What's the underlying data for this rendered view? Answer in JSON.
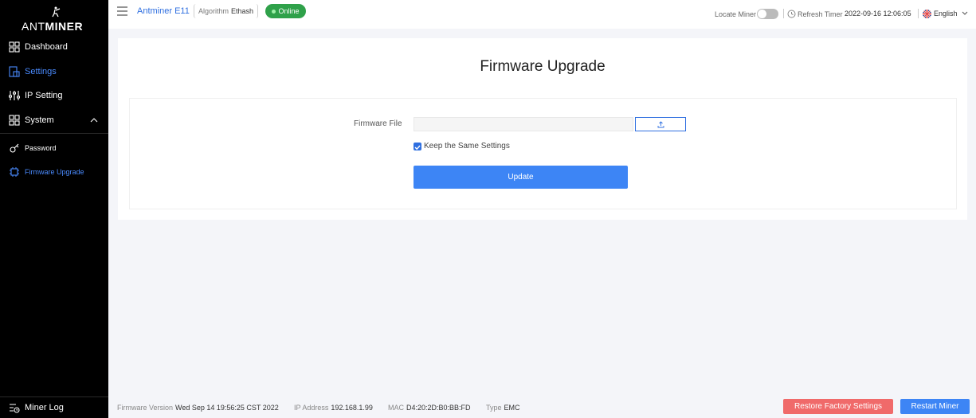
{
  "brand": {
    "logo_part1": "ANT",
    "logo_part2": "MINER"
  },
  "sidebar": {
    "items": [
      {
        "label": "Dashboard",
        "icon": "dashboard-icon"
      },
      {
        "label": "Settings",
        "icon": "settings-icon",
        "active": true
      },
      {
        "label": "IP Setting",
        "icon": "sliders-icon"
      },
      {
        "label": "System",
        "icon": "system-icon",
        "expanded": true
      },
      {
        "label": "Password",
        "icon": "key-icon"
      },
      {
        "label": "Firmware Upgrade",
        "icon": "chip-icon",
        "active": true
      }
    ],
    "footer_item": {
      "label": "Miner Log",
      "icon": "log-icon"
    }
  },
  "header": {
    "model": "Antminer E11",
    "algorithm_label": "Algorithm",
    "algorithm_value": "Ethash",
    "status": "Online",
    "locate_label": "Locate Miner",
    "locate_on": false,
    "refresh_label": "Refresh Timer",
    "refresh_time": "2022-09-16 12:06:05",
    "language": "English"
  },
  "main": {
    "title": "Firmware Upgrade",
    "firmware_file_label": "Firmware File",
    "firmware_file_value": "",
    "keep_settings_label": "Keep the Same Settings",
    "keep_settings_checked": true,
    "update_label": "Update"
  },
  "footer": {
    "firmware_version_label": "Firmware Version",
    "firmware_version": "Wed Sep 14 19:56:25 CST 2022",
    "ip_label": "IP Address",
    "ip": "192.168.1.99",
    "mac_label": "MAC",
    "mac": "D4:20:2D:B0:BB:FD",
    "type_label": "Type",
    "type": "EMC",
    "restore_label": "Restore Factory Settings",
    "restart_label": "Restart Miner"
  },
  "colors": {
    "accent": "#3d85f5",
    "link": "#2f6fe0",
    "online": "#2fa14a",
    "danger": "#f06a6a",
    "sidebar_bg": "#000000"
  }
}
